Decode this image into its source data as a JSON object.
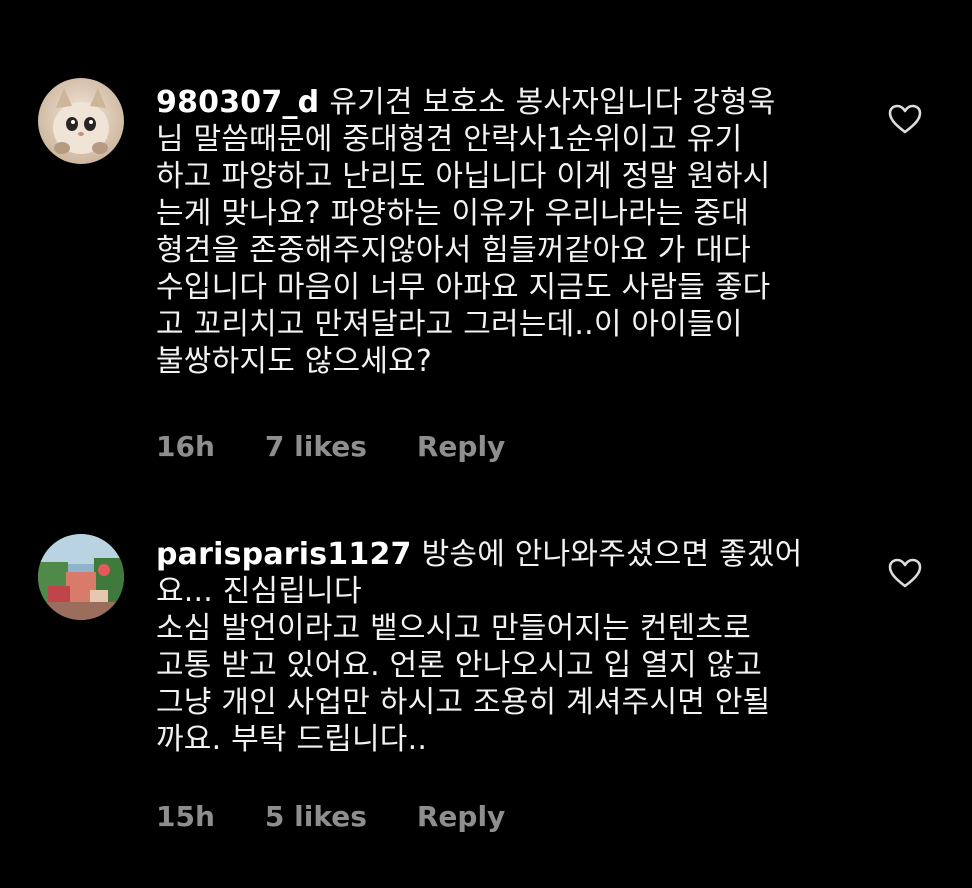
{
  "comments": [
    {
      "username": "980307_d",
      "text": "유기견 보호소 봉사자입니다 강형욱\n님 말씀때문에 중대형견 안락사1순위이고 유기\n하고 파양하고 난리도 아닙니다 이게 정말 원하시\n는게 맞나요? 파양하는 이유가 우리나라는 중대\n형견을 존중해주지않아서 힘들꺼같아요 가 대다\n수입니다 마음이 너무 아파요 지금도 사람들 좋다\n고 꼬리치고 만져달라고 그러는데..이 아이들이\n불쌍하지도 않으세요?",
      "time": "16h",
      "likes": "7 likes",
      "reply": "Reply",
      "avatar_icon": "cat-avatar"
    },
    {
      "username": "parisparis1127",
      "text": "방송에 안나와주셨으면 좋겠어\n요... 진심립니다\n소심 발언이라고 뱉으시고 만들어지는 컨텐츠로\n고통 받고 있어요. 언론 안나오시고 입 열지 않고\n그냥 개인 사업만 하시고 조용히 계셔주시면 안될\n까요. 부탁 드립니다..",
      "time": "15h",
      "likes": "5 likes",
      "reply": "Reply",
      "avatar_icon": "street-photo-avatar"
    }
  ],
  "colors": {
    "background": "#000000",
    "text": "#f2f2f2",
    "meta": "#8e8e8e"
  }
}
